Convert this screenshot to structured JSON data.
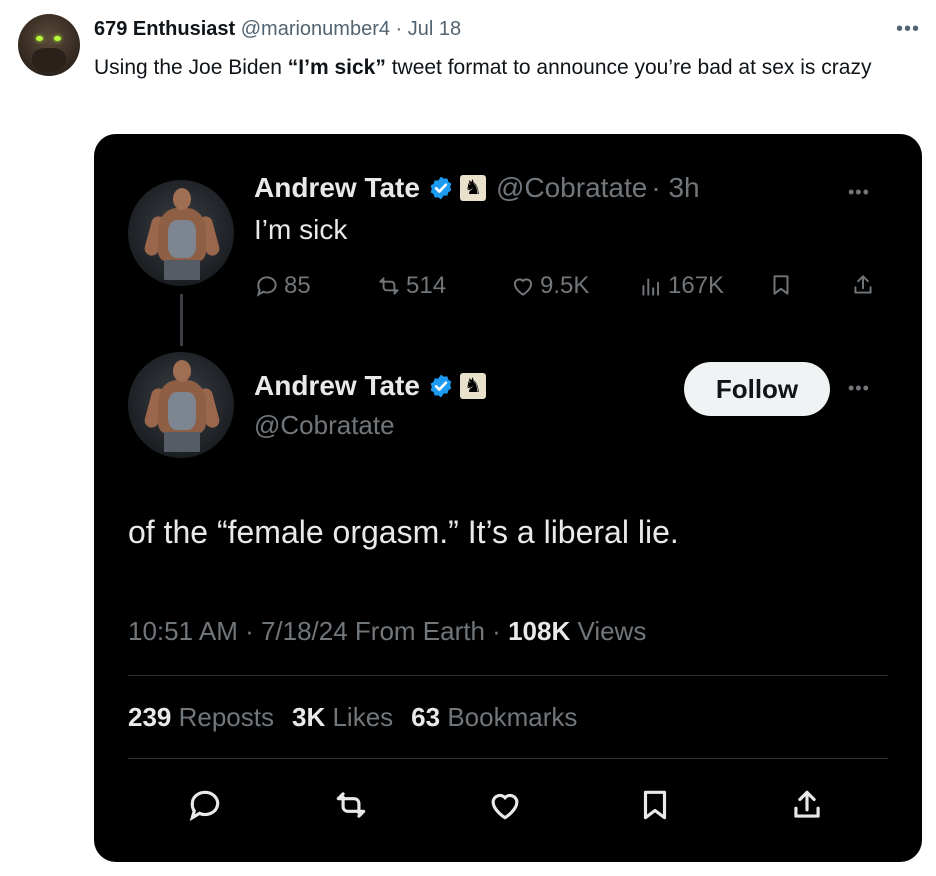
{
  "outer_tweet": {
    "display_name": "679 Enthusiast",
    "handle": "@marionumber4",
    "separator": "·",
    "date": "Jul 18",
    "text_before": "Using the Joe Biden ",
    "text_bold": "“I’m sick”",
    "text_after": " tweet format to announce you’re bad at sex is crazy",
    "more_icon": "more-horizontal-icon"
  },
  "quoted_tweet": {
    "display_name": "Andrew Tate",
    "handle": "@Cobratate",
    "time_ago": "· 3h",
    "text": "I’m sick",
    "replies": "85",
    "reposts": "514",
    "likes": "9.5K",
    "views": "167K"
  },
  "main_tweet": {
    "display_name": "Andrew Tate",
    "handle": "@Cobratate",
    "follow_label": "Follow",
    "text": "of the “female orgasm.” It’s a liberal lie.",
    "timestamp": "10:51 AM · 7/18/24 From Earth · ",
    "views_count": "108K",
    "views_label": " Views",
    "reposts_count": "239",
    "reposts_label": " Reposts",
    "likes_count": "3K",
    "likes_label": " Likes",
    "bookmarks_count": "63",
    "bookmarks_label": " Bookmarks"
  },
  "colors": {
    "verified_blue": "#1d9bf0",
    "card_bg": "#000000",
    "muted_text": "#71767b"
  }
}
